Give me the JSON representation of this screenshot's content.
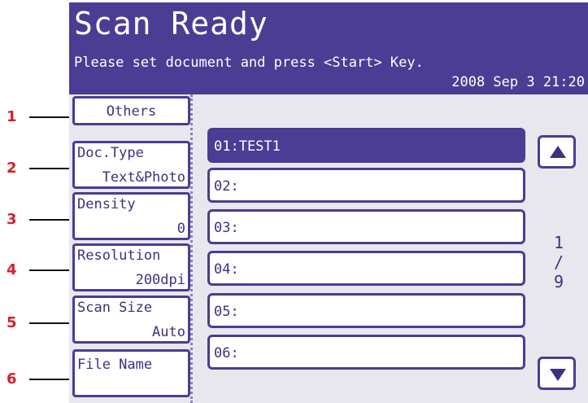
{
  "header": {
    "title": "Scan Ready",
    "subtitle": "Please set document and press <Start> Key.",
    "datetime": "2008 Sep  3 21:20"
  },
  "left_buttons": {
    "others": "Others",
    "doc_type": {
      "label": "Doc.Type",
      "value": "Text&Photo"
    },
    "density": {
      "label": "Density",
      "value": "0"
    },
    "resolution": {
      "label": "Resolution",
      "value": "200dpi"
    },
    "scan_size": {
      "label": "Scan Size",
      "value": "Auto"
    },
    "file_name": {
      "label": "File Name"
    }
  },
  "list": {
    "items": [
      "01:TEST1",
      "02:",
      "03:",
      "04:",
      "05:",
      "06:"
    ],
    "selected_index": 0
  },
  "pager": {
    "current": "1",
    "separator": "/",
    "total": "9"
  },
  "callouts": [
    "1",
    "2",
    "3",
    "4",
    "5",
    "6"
  ],
  "colors": {
    "accent": "#4a3d93",
    "callout": "#d3212c"
  }
}
